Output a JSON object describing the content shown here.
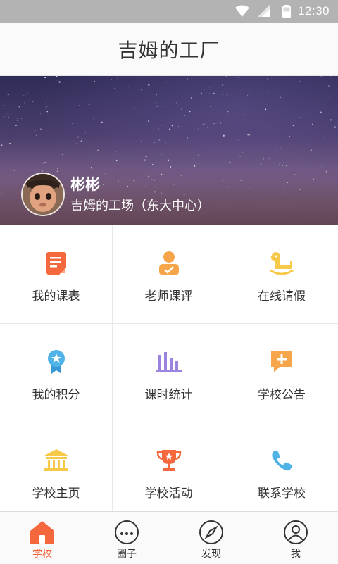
{
  "status_bar": {
    "time": "12:30"
  },
  "header": {
    "title": "吉姆的工厂"
  },
  "profile": {
    "name": "彬彬",
    "organization": "吉姆的工场（东大中心）"
  },
  "menu": [
    {
      "label": "我的课表",
      "icon": "schedule-icon",
      "color": "#f5683d"
    },
    {
      "label": "老师课评",
      "icon": "teacher-review-icon",
      "color": "#f7a54a"
    },
    {
      "label": "在线请假",
      "icon": "rocking-horse-icon",
      "color": "#f7c948"
    },
    {
      "label": "我的积分",
      "icon": "badge-icon",
      "color": "#4fb3e8"
    },
    {
      "label": "课时统计",
      "icon": "bar-chart-icon",
      "color": "#9b83e0"
    },
    {
      "label": "学校公告",
      "icon": "announcement-icon",
      "color": "#f7a54a"
    },
    {
      "label": "学校主页",
      "icon": "school-building-icon",
      "color": "#f7c948"
    },
    {
      "label": "学校活动",
      "icon": "trophy-icon",
      "color": "#f5683d"
    },
    {
      "label": "联系学校",
      "icon": "phone-icon",
      "color": "#4fb3e8"
    }
  ],
  "tabs": [
    {
      "label": "学校",
      "icon": "home-icon",
      "active": true
    },
    {
      "label": "圈子",
      "icon": "chat-icon",
      "active": false
    },
    {
      "label": "发现",
      "icon": "compass-icon",
      "active": false
    },
    {
      "label": "我",
      "icon": "user-icon",
      "active": false
    }
  ],
  "colors": {
    "accent": "#f5683d",
    "status_bar": "#b3b3b3"
  }
}
